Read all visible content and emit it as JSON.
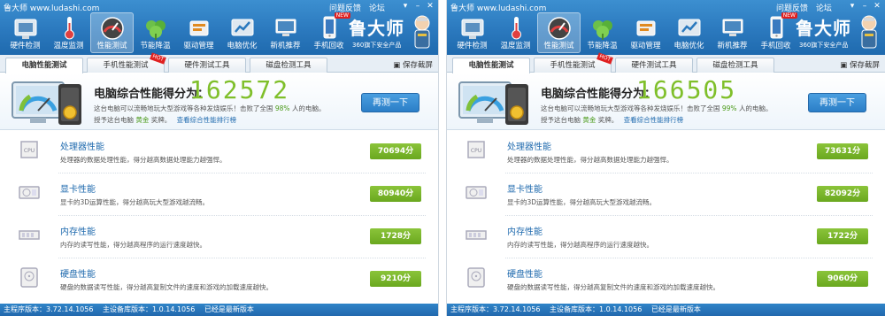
{
  "windows": [
    {
      "title": "鲁大师 www.ludashi.com",
      "top_links": [
        "问题反馈",
        "论坛"
      ],
      "toolbar": [
        {
          "label": "硬件检测",
          "icon": "hardware-icon"
        },
        {
          "label": "温度监测",
          "icon": "thermometer-icon"
        },
        {
          "label": "性能测试",
          "icon": "speedometer-icon",
          "active": true
        },
        {
          "label": "节能降温",
          "icon": "leaf-icon"
        },
        {
          "label": "驱动管理",
          "icon": "driver-icon"
        },
        {
          "label": "电脑优化",
          "icon": "optimize-icon"
        },
        {
          "label": "新机推荐",
          "icon": "computer-icon"
        },
        {
          "label": "手机回收",
          "icon": "phone-icon",
          "badge": "NEW"
        }
      ],
      "brand": {
        "name": "鲁大师",
        "sub": "360旗下安全产品"
      },
      "tabs": [
        {
          "label": "电脑性能测试",
          "active": true
        },
        {
          "label": "手机性能测试",
          "hot": "HOT"
        },
        {
          "label": "硬件测试工具"
        },
        {
          "label": "磁盘检测工具"
        }
      ],
      "save_label": "保存截屏",
      "score": {
        "title": "电脑综合性能得分为：",
        "value": "162572",
        "desc_pre": "这台电脑可以流畅地玩大型游戏等各种发烧娱乐！击败了全国",
        "percent": "98%",
        "desc_post": "人的电脑。",
        "award_pre": "授予这台电脑",
        "award": "黄金",
        "award_post": "奖牌。",
        "rank_link": "查看综合性能排行榜",
        "retest_label": "再测一下"
      },
      "items": [
        {
          "name": "处理器性能",
          "desc": "处理器的数据处理性能，得分越高数据处理能力越强悍。",
          "score": "70694分",
          "icon": "cpu-icon"
        },
        {
          "name": "显卡性能",
          "desc": "显卡的3D运算性能，得分越高玩大型游戏越流畅。",
          "score": "80940分",
          "icon": "graphics-card-icon"
        },
        {
          "name": "内存性能",
          "desc": "内存的读写性能，得分越高程序的运行速度越快。",
          "score": "1728分",
          "icon": "memory-icon"
        },
        {
          "name": "硬盘性能",
          "desc": "硬盘的数据读写性能，得分越高复制文件的速度和游戏的加载速度越快。",
          "score": "9210分",
          "icon": "hard-disk-icon"
        }
      ],
      "status": {
        "program": "主程序版本：3.72.14.1056",
        "database": "主设备库版本：1.0.14.1056",
        "latest": "已经是最新版本"
      }
    },
    {
      "title": "鲁大师 www.ludashi.com",
      "top_links": [
        "问题反馈",
        "论坛"
      ],
      "toolbar": [
        {
          "label": "硬件检测",
          "icon": "hardware-icon"
        },
        {
          "label": "温度监测",
          "icon": "thermometer-icon"
        },
        {
          "label": "性能测试",
          "icon": "speedometer-icon",
          "active": true
        },
        {
          "label": "节能降温",
          "icon": "leaf-icon"
        },
        {
          "label": "驱动管理",
          "icon": "driver-icon"
        },
        {
          "label": "电脑优化",
          "icon": "optimize-icon"
        },
        {
          "label": "新机推荐",
          "icon": "computer-icon"
        },
        {
          "label": "手机回收",
          "icon": "phone-icon",
          "badge": "NEW"
        }
      ],
      "brand": {
        "name": "鲁大师",
        "sub": "360旗下安全产品"
      },
      "tabs": [
        {
          "label": "电脑性能测试",
          "active": true
        },
        {
          "label": "手机性能测试",
          "hot": "HOT"
        },
        {
          "label": "硬件测试工具"
        },
        {
          "label": "磁盘检测工具"
        }
      ],
      "save_label": "保存截屏",
      "score": {
        "title": "电脑综合性能得分为：",
        "value": "166505",
        "desc_pre": "这台电脑可以流畅地玩大型游戏等各种发烧娱乐！击败了全国",
        "percent": "99%",
        "desc_post": "人的电脑。",
        "award_pre": "授予这台电脑",
        "award": "黄金",
        "award_post": "奖牌。",
        "rank_link": "查看综合性能排行榜",
        "retest_label": "再测一下"
      },
      "items": [
        {
          "name": "处理器性能",
          "desc": "处理器的数据处理性能，得分越高数据处理能力越强悍。",
          "score": "73631分",
          "icon": "cpu-icon"
        },
        {
          "name": "显卡性能",
          "desc": "显卡的3D运算性能，得分越高玩大型游戏越流畅。",
          "score": "82092分",
          "icon": "graphics-card-icon"
        },
        {
          "name": "内存性能",
          "desc": "内存的读写性能，得分越高程序的运行速度越快。",
          "score": "1722分",
          "icon": "memory-icon"
        },
        {
          "name": "硬盘性能",
          "desc": "硬盘的数据读写性能，得分越高复制文件的速度和游戏的加载速度越快。",
          "score": "9060分",
          "icon": "hard-disk-icon"
        }
      ],
      "status": {
        "program": "主程序版本：3.72.14.1056",
        "database": "主设备库版本：1.0.14.1056",
        "latest": "已经是最新版本"
      }
    }
  ]
}
